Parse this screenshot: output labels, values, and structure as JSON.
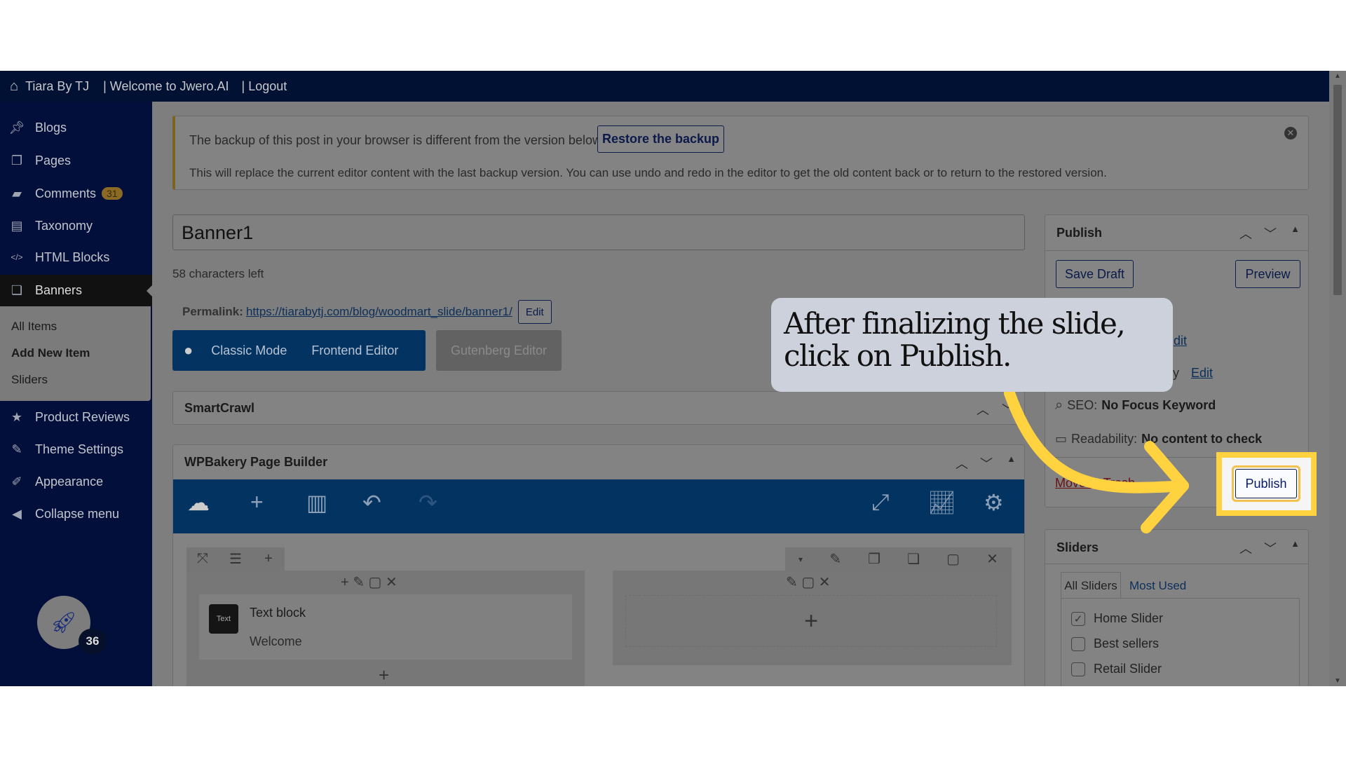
{
  "adminbar": {
    "site": "Tiara By TJ",
    "welcome": "| Welcome to Jwero.AI",
    "logout": "| Logout"
  },
  "sidebar": {
    "items": [
      {
        "label": "Blogs",
        "icon": "pin-icon"
      },
      {
        "label": "Pages",
        "icon": "pages-icon"
      },
      {
        "label": "Comments",
        "icon": "comment-icon",
        "badge": "31"
      },
      {
        "label": "Taxonomy",
        "icon": "archive-icon"
      },
      {
        "label": "HTML Blocks",
        "icon": "code-block-icon"
      },
      {
        "label": "Banners",
        "icon": "banners-icon",
        "active": true
      },
      {
        "label": "Product Reviews",
        "icon": "star-icon"
      },
      {
        "label": "Theme Settings",
        "icon": "brush-icon"
      },
      {
        "label": "Appearance",
        "icon": "appearance-icon"
      },
      {
        "label": "Collapse menu",
        "icon": "collapse-icon"
      }
    ],
    "submenu": [
      "All Items",
      "Add New Item",
      "Sliders"
    ],
    "avatar_badge": "36"
  },
  "notice": {
    "text": "The backup of this post in your browser is different from the version below.",
    "restore": "Restore the backup",
    "detail": "This will replace the current editor content with the last backup version. You can use undo and redo in the editor to get the old content back or to return to the restored version."
  },
  "editor": {
    "title": "Banner1",
    "chars_left": "58 characters left",
    "permalink_label": "Permalink:",
    "permalink_url": "https://tiarabytj.com/blog/woodmart_slide/banner1/",
    "edit": "Edit",
    "classic": "Classic Mode",
    "frontend": "Frontend Editor",
    "gutenberg": "Gutenberg Editor"
  },
  "smartcrawl": {
    "title": "SmartCrawl"
  },
  "wpbakery": {
    "title": "WPBakery Page Builder",
    "element_title": "Text block",
    "element_icon_text": "Text",
    "element_content": "Welcome"
  },
  "publish": {
    "title": "Publish",
    "save_draft": "Save Draft",
    "preview": "Preview",
    "partial1": "dit",
    "partial2_prefix": "ely",
    "partial2_link": "Edit",
    "seo_label": "SEO:",
    "seo_value": "No Focus Keyword",
    "read_label": "Readability:",
    "read_value": "No content to check",
    "trash": "Move to Trash",
    "publish": "Publish"
  },
  "sliders": {
    "title": "Sliders",
    "tab_all": "All Sliders",
    "tab_used": "Most Used",
    "items": [
      {
        "label": "Home Slider",
        "checked": true
      },
      {
        "label": "Best sellers",
        "checked": false
      },
      {
        "label": "Retail Slider",
        "checked": false
      }
    ]
  },
  "callout": {
    "text": "After finalizing the slide, click on Publish.",
    "highlight_color": "#FFD23F"
  }
}
